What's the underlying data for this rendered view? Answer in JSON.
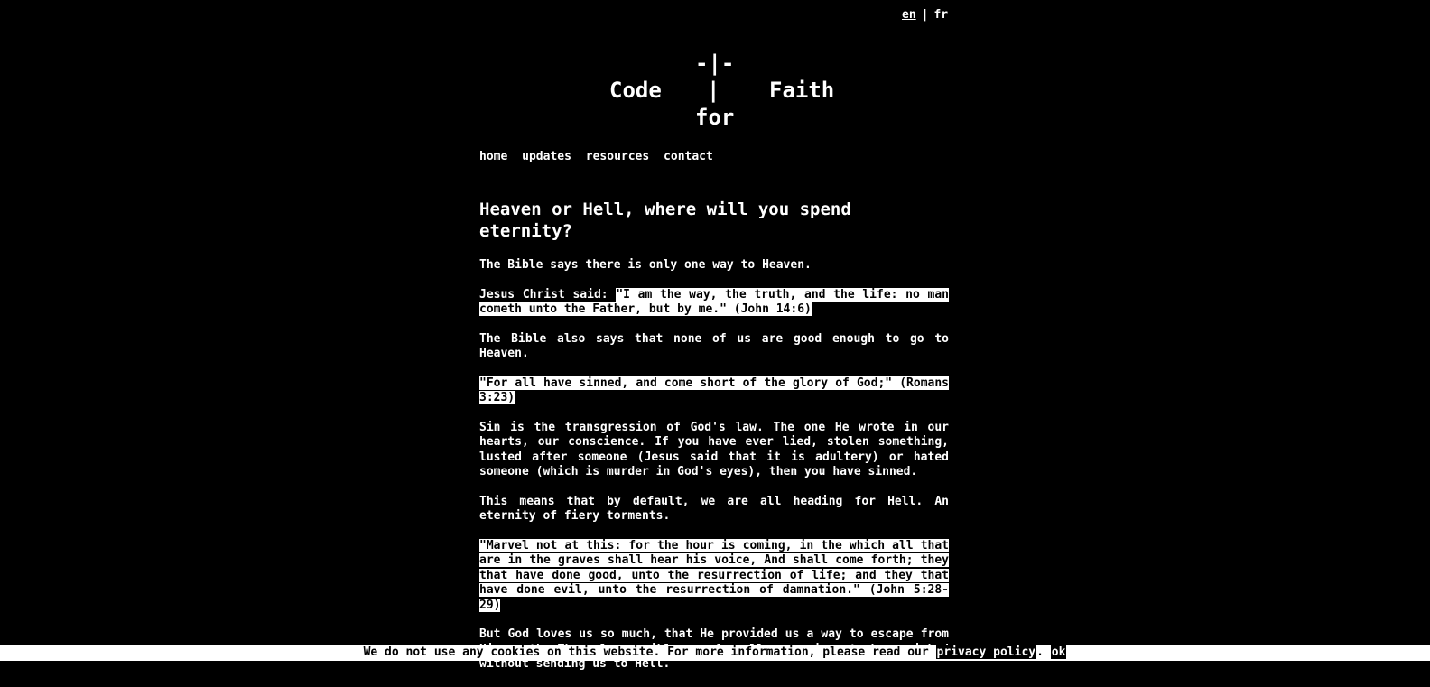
{
  "lang": {
    "en": "en",
    "separator": "|",
    "fr": "fr"
  },
  "logo": {
    "top": "-|-",
    "left": "Code",
    "center": "|",
    "right": "Faith",
    "bottom": "for"
  },
  "nav": {
    "items": [
      "home",
      "updates",
      "resources",
      "contact"
    ]
  },
  "article": {
    "title": "Heaven or Hell, where will you spend eternity?",
    "p1": "The Bible says there is only one way to Heaven.",
    "p2_prefix": "Jesus Christ said: ",
    "p2_quote": "\"I am the way, the truth, and the life: no man cometh unto the Father, but by me.\" (John 14:6)",
    "p3": "The Bible also says that none of us are good enough to go to Heaven.",
    "p4_quote": "\"For all have sinned, and come short of the glory of God;\" (Romans 3:23)",
    "p5": "Sin is the transgression of God's law. The one He wrote in our hearts, our conscience. If you have ever lied, stolen something, lusted after someone (Jesus said that it is adultery) or hated someone (which is murder in God's eyes), then you have sinned.",
    "p6": "This means that by default, we are all heading for Hell. An eternity of fiery torments.",
    "p7_quote": "\"Marvel not at this: for the hour is coming, in the which all that are in the graves shall hear his voice, And shall come forth; they that have done good, unto the resurrection of life; and they that have done evil, unto the resurrection of damnation.\" (John 5:28-29)",
    "p8": "But God loves us so much, that He provided us a way to escape from His wrath. The only possible way for all our crimes to be punished without sending us to Hell."
  },
  "cookie": {
    "text": "We do not use any cookies on this website. For more information, please read our ",
    "link": "privacy policy",
    "after": ". ",
    "ok": "ok"
  }
}
